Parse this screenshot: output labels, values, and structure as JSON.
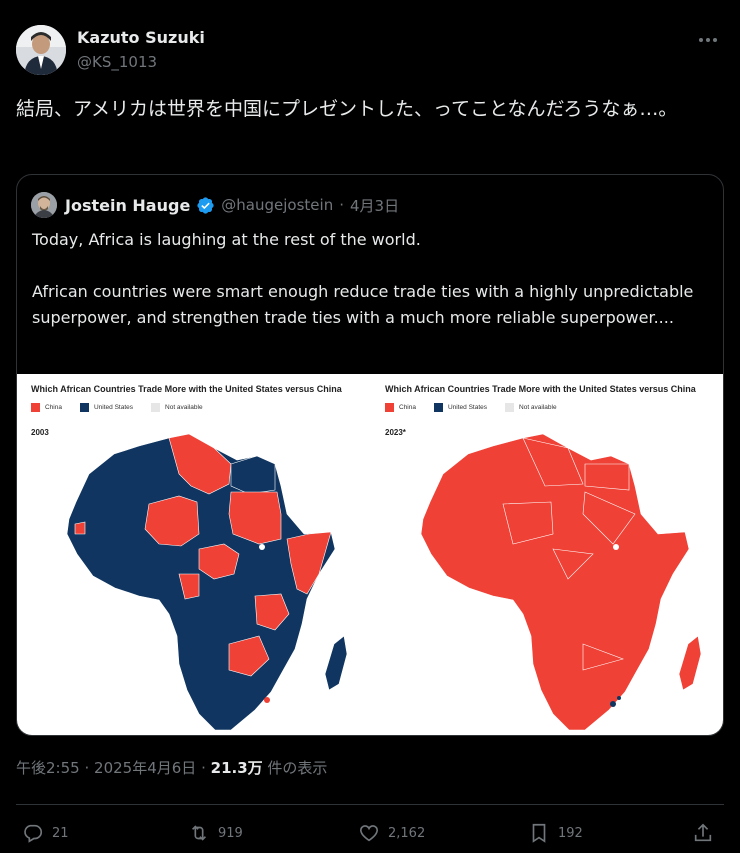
{
  "author": {
    "name": "Kazuto Suzuki",
    "handle": "@KS_1013"
  },
  "tweet": {
    "text": "結局、アメリカは世界を中国にプレゼントした、ってことなんだろうなぁ…。"
  },
  "quoted": {
    "name": "Jostein Hauge",
    "handle": "@haugejostein",
    "separator": "·",
    "date": "4月3日",
    "paragraph1": "Today, Africa is laughing at the rest of the world.",
    "paragraph2": "African countries were smart enough reduce trade ties with a highly unpredictable superpower, and strengthen trade ties with a much more reliable superpower...."
  },
  "maps": {
    "left": {
      "title": "Which African Countries Trade More with the United States versus China",
      "legend": [
        "China",
        "United States",
        "Not available"
      ],
      "year": "2003"
    },
    "right": {
      "title": "Which African Countries Trade More with the United States versus China",
      "legend": [
        "China",
        "United States",
        "Not available"
      ],
      "year": "2023*"
    }
  },
  "colors": {
    "china": "#ef4136",
    "united_states": "#0f3560",
    "not_available": "#e6e6e6",
    "verified": "#1d9bf0"
  },
  "meta": {
    "time": "午後2:55",
    "dot1": "·",
    "date": "2025年4月6日",
    "dot2": "·",
    "views": "21.3万",
    "views_suffix": " 件の表示"
  },
  "actions": {
    "replies": "21",
    "reposts": "919",
    "likes": "2,162",
    "bookmarks": "192"
  },
  "icons": [
    "more-icon",
    "verified-icon",
    "reply-icon",
    "repost-icon",
    "like-icon",
    "bookmark-icon",
    "share-icon"
  ]
}
